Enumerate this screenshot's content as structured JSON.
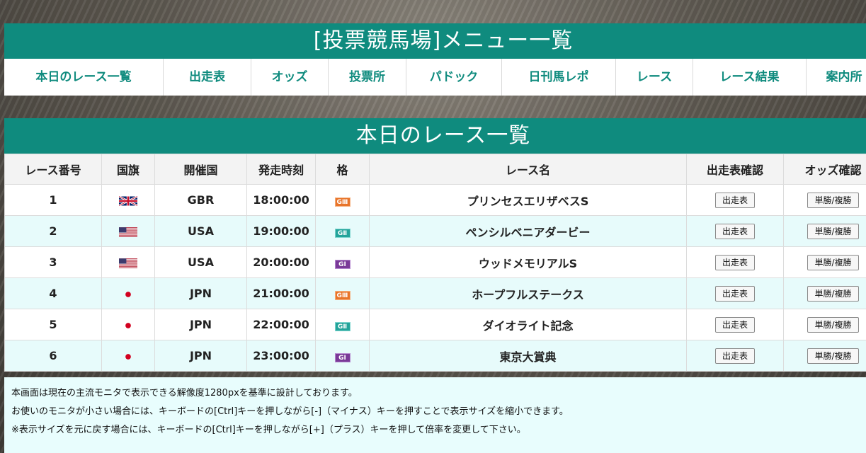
{
  "menu": {
    "title": "[投票競馬場]メニュー一覧",
    "items": [
      {
        "label": "本日のレース一覧"
      },
      {
        "label": "出走表"
      },
      {
        "label": "オッズ"
      },
      {
        "label": "投票所"
      },
      {
        "label": "パドック"
      },
      {
        "label": "日刊馬レポ"
      },
      {
        "label": "レース"
      },
      {
        "label": "レース結果"
      },
      {
        "label": "案内所"
      }
    ]
  },
  "races": {
    "title": "本日のレース一覧",
    "columns": [
      "レース番号",
      "国旗",
      "開催国",
      "発走時刻",
      "格",
      "レース名",
      "出走表確認",
      "オッズ確認"
    ],
    "rows": [
      {
        "no": "1",
        "flag": "uk-flag-icon",
        "country": "GBR",
        "time": "18:00:00",
        "grade": "GⅢ",
        "grade_color": "#e8742a",
        "name": "プリンセスエリザベスS",
        "entry_button": "出走表",
        "odds_button": "単勝/複勝"
      },
      {
        "no": "2",
        "flag": "us-flag-icon",
        "country": "USA",
        "time": "19:00:00",
        "grade": "GⅡ",
        "grade_color": "#23a39a",
        "name": "ペンシルベニアダービー",
        "entry_button": "出走表",
        "odds_button": "単勝/複勝"
      },
      {
        "no": "3",
        "flag": "us-flag-icon",
        "country": "USA",
        "time": "20:00:00",
        "grade": "GⅠ",
        "grade_color": "#7a3a98",
        "name": "ウッドメモリアルS",
        "entry_button": "出走表",
        "odds_button": "単勝/複勝"
      },
      {
        "no": "4",
        "flag": "japan-flag-icon",
        "country": "JPN",
        "time": "21:00:00",
        "grade": "GⅢ",
        "grade_color": "#e8742a",
        "name": "ホープフルステークス",
        "entry_button": "出走表",
        "odds_button": "単勝/複勝"
      },
      {
        "no": "5",
        "flag": "japan-flag-icon",
        "country": "JPN",
        "time": "22:00:00",
        "grade": "GⅡ",
        "grade_color": "#23a39a",
        "name": "ダイオライト記念",
        "entry_button": "出走表",
        "odds_button": "単勝/複勝"
      },
      {
        "no": "6",
        "flag": "japan-flag-icon",
        "country": "JPN",
        "time": "23:00:00",
        "grade": "GⅠ",
        "grade_color": "#7a3a98",
        "name": "東京大賞典",
        "entry_button": "出走表",
        "odds_button": "単勝/複勝"
      }
    ]
  },
  "notice": {
    "lines": [
      "本画面は現在の主流モニタで表示できる解像度1280pxを基準に設計しております。",
      "お使いのモニタが小さい場合には、キーボードの[Ctrl]キーを押しながら[-]（マイナス）キーを押すことで表示サイズを縮小できます。",
      "※表示サイズを元に戻す場合には、キーボードの[Ctrl]キーを押しながら[+]（プラス）キーを押して倍率を変更して下さい。"
    ]
  },
  "colors": {
    "accent": "#0f8b7e",
    "row_alt": "#e7fbfb",
    "notice_bg": "#e8fdfd"
  }
}
